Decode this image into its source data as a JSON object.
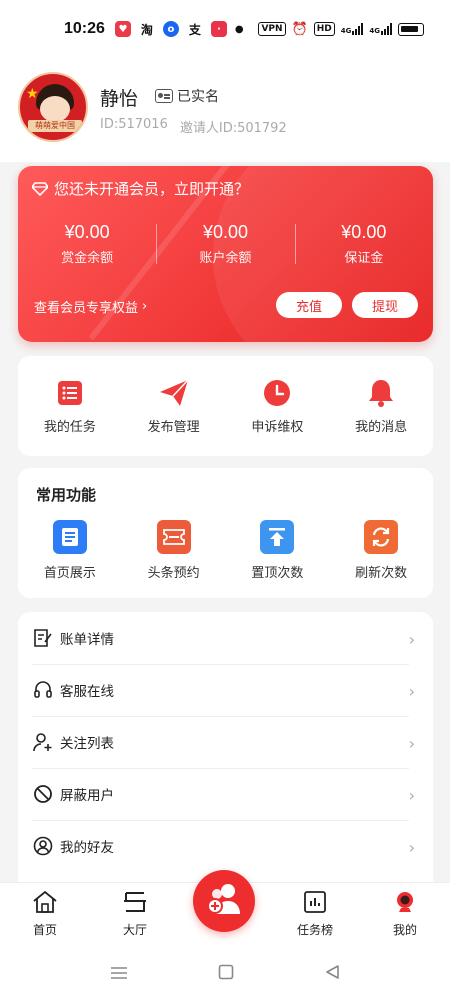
{
  "status_bar": {
    "time": "10:26",
    "vpn": "VPN",
    "hd": "HD",
    "net1": "4G",
    "net2": "4G"
  },
  "profile": {
    "avatar_banner": "萌萌爱中国",
    "name": "静怡",
    "verified_label": "已实名",
    "id_text": "ID:517016",
    "inviter_text": "邀请人ID:501792"
  },
  "member_card": {
    "prompt": "您还未开通会员，立即开通？",
    "stats": [
      {
        "value": "¥0.00",
        "label": "赏金余额"
      },
      {
        "value": "¥0.00",
        "label": "账户余额"
      },
      {
        "value": "¥0.00",
        "label": "保证金"
      }
    ],
    "benefits_link": "查看会员专享权益",
    "recharge_label": "充值",
    "withdraw_label": "提现"
  },
  "tasks_panel": {
    "items": [
      {
        "label": "我的任务",
        "icon": "list-icon"
      },
      {
        "label": "发布管理",
        "icon": "send-icon"
      },
      {
        "label": "申诉维权",
        "icon": "clock-icon"
      },
      {
        "label": "我的消息",
        "icon": "bell-icon"
      }
    ]
  },
  "common_panel": {
    "title": "常用功能",
    "items": [
      {
        "label": "首页展示",
        "icon": "document-icon",
        "color": "#2f7df6"
      },
      {
        "label": "头条预约",
        "icon": "ticket-icon",
        "color": "#ec5c3a"
      },
      {
        "label": "置顶次数",
        "icon": "pin-top-icon",
        "color": "#3d95f0"
      },
      {
        "label": "刷新次数",
        "icon": "refresh-icon",
        "color": "#ef6a34"
      }
    ]
  },
  "menu_list": {
    "items": [
      {
        "label": "账单详情",
        "icon": "bill-icon"
      },
      {
        "label": "客服在线",
        "icon": "headset-icon"
      },
      {
        "label": "关注列表",
        "icon": "user-add-icon"
      },
      {
        "label": "屏蔽用户",
        "icon": "block-icon"
      },
      {
        "label": "我的好友",
        "icon": "friend-icon"
      }
    ]
  },
  "bottom_nav": {
    "items": [
      {
        "label": "首页",
        "icon": "home-icon"
      },
      {
        "label": "大厅",
        "icon": "hall-icon"
      },
      {
        "label": "任务榜",
        "icon": "chart-icon"
      },
      {
        "label": "我的",
        "icon": "profile-icon"
      }
    ],
    "center_icon": "publish-users-icon"
  },
  "colors": {
    "accent": "#ee2e2e",
    "background": "#f4f4f4"
  }
}
